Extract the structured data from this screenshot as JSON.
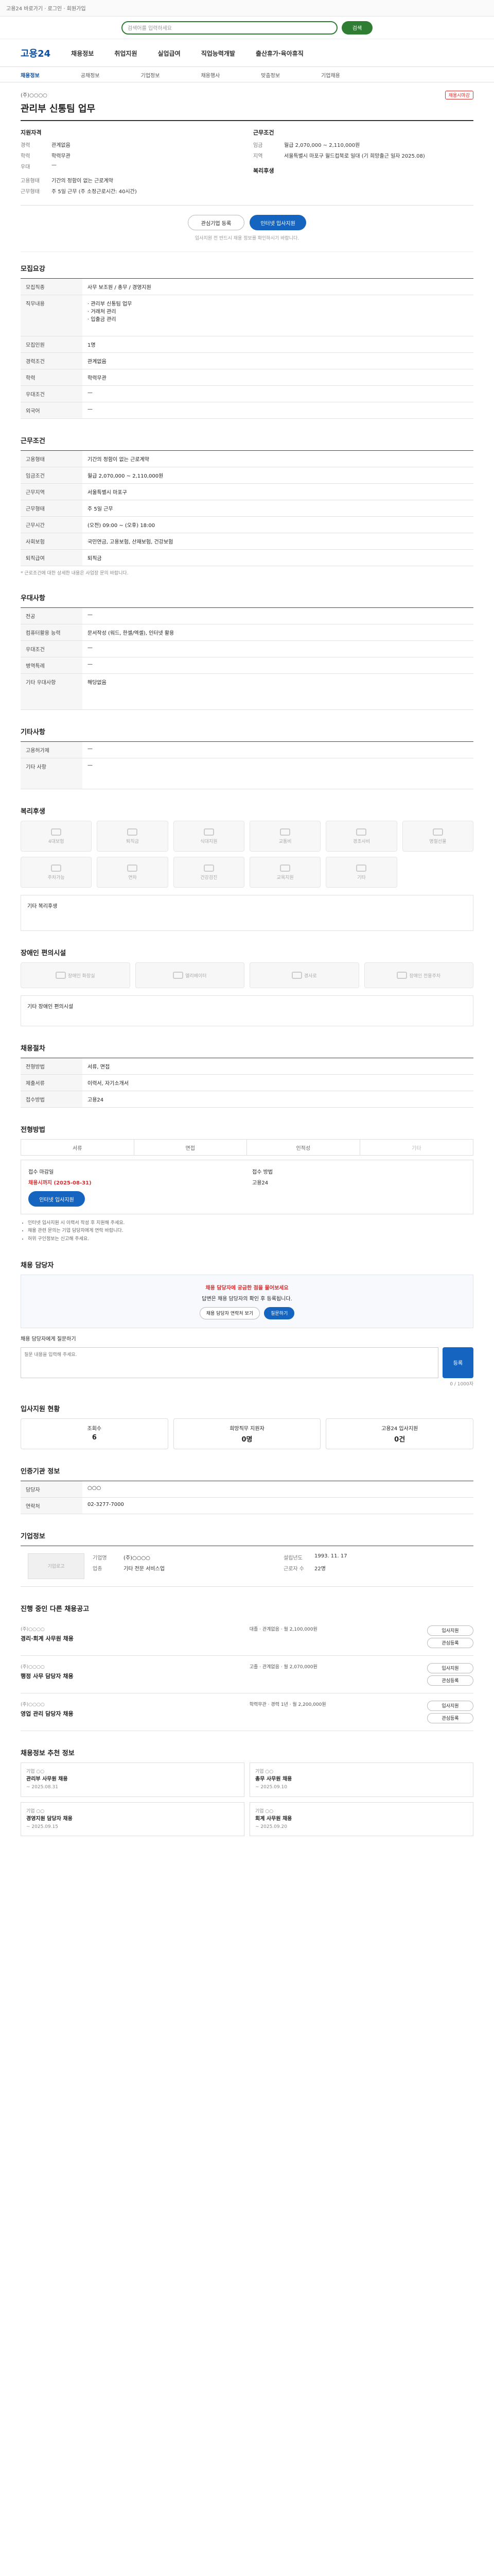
{
  "topbar": {
    "text": "고용24 바로가기 · 로그인 · 회원가입"
  },
  "search": {
    "placeholder": "검색어를 입력하세요",
    "button": "검색"
  },
  "gnb": {
    "logo": "고용24",
    "menus": [
      "채용정보",
      "취업지원",
      "실업급여",
      "직업능력개발",
      "출산휴가·육아휴직"
    ]
  },
  "subnav": {
    "items": [
      "채용정보",
      "공채정보",
      "기업정보",
      "채용행사",
      "맞춤정보",
      "기업채용"
    ]
  },
  "head": {
    "company": "(주)○○○○",
    "title": "관리부 신통팀 업무",
    "badge": "채용시마감"
  },
  "summary": {
    "left_title": "지원자격",
    "right_title": "근무조건",
    "left": [
      {
        "k": "경력",
        "v": "관계없음"
      },
      {
        "k": "학력",
        "v": "학력무관"
      },
      {
        "k": "우대",
        "v": "—"
      }
    ],
    "right": [
      {
        "k": "임금",
        "v": "월급 2,070,000 ~ 2,110,000원"
      },
      {
        "k": "지역",
        "v": "서울특별시 마포구 월드컵북로 일대 (기 희망출근 일자 2025.08)"
      }
    ],
    "left2": [
      {
        "k": "고용형태",
        "v": "기간의 정함이 없는 근로계약"
      },
      {
        "k": "근무형태",
        "v": "주 5일 근무 (주 소정근로시간: 40시간)"
      }
    ],
    "right2_title": "복리후생"
  },
  "actions": {
    "save": "관심기업 등록",
    "apply": "인터넷 입사지원"
  },
  "note": "입사지원 전 반드시 채용 정보를 확인하시기 바랍니다.",
  "recruit": {
    "title": "모집요강",
    "rows": [
      {
        "k": "모집직종",
        "v": "사무 보조원 / 총무 / 경영지원"
      },
      {
        "k": "직무내용",
        "v": "· 관리부 신통팀 업무\n· 거래처 관리\n· 입출금 관리"
      },
      {
        "k": "모집인원",
        "v": "1명"
      },
      {
        "k": "경력조건",
        "v": "관계없음"
      },
      {
        "k": "학력",
        "v": "학력무관"
      },
      {
        "k": "우대조건",
        "v": "—"
      },
      {
        "k": "외국어",
        "v": "—"
      }
    ]
  },
  "conditions": {
    "title": "근무조건",
    "rows": [
      {
        "k": "고용형태",
        "v": "기간의 정함이 없는 근로계약"
      },
      {
        "k": "임금조건",
        "v": "월급 2,070,000 ~ 2,110,000원"
      },
      {
        "k": "근무지역",
        "v": "서울특별시 마포구"
      },
      {
        "k": "근무형태",
        "v": "주 5일 근무"
      },
      {
        "k": "근무시간",
        "v": "(오전) 09:00 ~ (오후) 18:00"
      },
      {
        "k": "사회보험",
        "v": "국민연금, 고용보험, 산재보험, 건강보험"
      },
      {
        "k": "퇴직급여",
        "v": "퇴직금"
      }
    ],
    "foot": "* 근로조건에 대한 상세한 내용은 사업장 문의 바랍니다."
  },
  "prefer": {
    "title": "우대사항",
    "rows": [
      {
        "k": "전공",
        "v": "—"
      },
      {
        "k": "컴퓨터활용 능력",
        "v": "문서작성 (워드, 한셀/엑셀), 인터넷 활용"
      },
      {
        "k": "우대조건",
        "v": "—"
      },
      {
        "k": "병역특례",
        "v": "—"
      },
      {
        "k": "기타 우대사항",
        "v": "해당없음"
      }
    ]
  },
  "etc": {
    "title": "기타사항",
    "rows": [
      {
        "k": "고용허가제",
        "v": "—"
      },
      {
        "k": "기타 사항",
        "v": "—"
      }
    ]
  },
  "welfare": {
    "title": "복리후생",
    "tiles": [
      "4대보험",
      "퇴직금",
      "식대지원",
      "교통비",
      "경조사비",
      "명절선물",
      "주차가능",
      "연차",
      "건강검진",
      "교육지원",
      "기타"
    ],
    "note": "기타 복리후생"
  },
  "disabled": {
    "title": "장애인 편의시설",
    "tiles": [
      "장애인 화장실",
      "엘리베이터",
      "경사로",
      "장애인 전용주차"
    ],
    "note": "기타 장애인 편의시설"
  },
  "process": {
    "title": "채용절차",
    "rows": [
      {
        "k": "전형방법",
        "v": "서류, 면접"
      },
      {
        "k": "제출서류",
        "v": "이력서, 자기소개서"
      },
      {
        "k": "접수방법",
        "v": "고용24"
      }
    ]
  },
  "apply_method": {
    "title": "전형방법",
    "methods": [
      "서류",
      "면접",
      "인적성",
      "기타"
    ],
    "deadline_label": "접수 마감일",
    "deadline": "채용시까지 (2025-08-31)",
    "method_label": "접수 방법",
    "method": "고용24",
    "apply_btn": "인터넷 입사지원",
    "bullets": [
      "인터넷 입사지원 시 이력서 작성 후 지원해 주세요.",
      "채용 관련 문의는 기업 담당자에게 연락 바랍니다.",
      "허위 구인정보는 신고해 주세요."
    ]
  },
  "qa": {
    "title": "채용 담당자",
    "q": "채용 담당자에 궁금한 점을 물어보세요",
    "desc": "답변은 채용 담당자의 확인 후 등록됩니다.",
    "btn1": "채용 담당자 연락처 보기",
    "btn2": "질문하기",
    "ask_label": "채용 담당자에게 질문하기",
    "ask_placeholder": "질문 내용을 입력해 주세요.",
    "ask_btn": "등록",
    "count": "0 / 1000자"
  },
  "stats": {
    "title": "입사지원 현황",
    "items": [
      {
        "k": "조회수",
        "v": "6"
      },
      {
        "k": "희망직무 지원자",
        "v": "0명"
      },
      {
        "k": "고용24 입사지원",
        "v": "0건"
      }
    ]
  },
  "manager": {
    "title": "인증기관 정보",
    "rows": [
      {
        "k": "담당자",
        "v": "○○○"
      },
      {
        "k": "연락처",
        "v": "02-3277-7000"
      }
    ]
  },
  "companyinfo": {
    "title": "기업정보",
    "logo": "기업로고",
    "rows": [
      {
        "k": "기업명",
        "v": "(주)○○○○"
      },
      {
        "k": "업종",
        "v": "기타 전문 서비스업"
      },
      {
        "k": "설립년도",
        "v": "1993. 11. 17"
      },
      {
        "k": "근로자 수",
        "v": "22명"
      }
    ]
  },
  "jobs": {
    "title": "진행 중인 다른 채용공고",
    "items": [
      {
        "co": "(주)○○○○",
        "t": "경리·회계 사무원 채용",
        "m": "대졸 · 관계없음 · 월 2,100,000원",
        "b1": "입사지원",
        "b2": "관심등록"
      },
      {
        "co": "(주)○○○○",
        "t": "행정 사무 담당자 채용",
        "m": "고졸 · 관계없음 · 월 2,070,000원",
        "b1": "입사지원",
        "b2": "관심등록"
      },
      {
        "co": "(주)○○○○",
        "t": "영업 관리 담당자 채용",
        "m": "학력무관 · 경력 1년 · 월 2,200,000원",
        "b1": "입사지원",
        "b2": "관심등록"
      }
    ]
  },
  "recommend": {
    "title": "채용정보 추천 정보",
    "cards": [
      {
        "co": "기업 ○○",
        "t": "관리부 사무원 채용",
        "d": "~ 2025.08.31"
      },
      {
        "co": "기업 ○○",
        "t": "총무 사무원 채용",
        "d": "~ 2025.09.10"
      },
      {
        "co": "기업 ○○",
        "t": "경영지원 담당자 채용",
        "d": "~ 2025.09.15"
      },
      {
        "co": "기업 ○○",
        "t": "회계 사무원 채용",
        "d": "~ 2025.09.20"
      }
    ]
  }
}
